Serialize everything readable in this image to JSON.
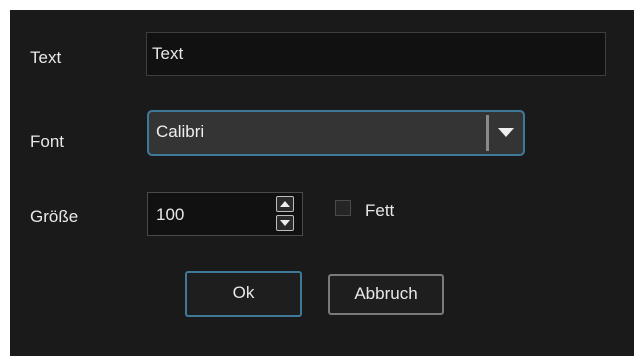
{
  "dialog": {
    "text_row": {
      "label": "Text",
      "value": "Text"
    },
    "font_row": {
      "label": "Font",
      "selected": "Calibri",
      "dropdown_icon": "chevron-down-icon"
    },
    "size_row": {
      "label": "Größe",
      "value": "100",
      "up_icon": "arrow-up-icon",
      "down_icon": "arrow-down-icon"
    },
    "bold": {
      "label": "Fett",
      "checked": false
    },
    "buttons": {
      "ok": "Ok",
      "cancel": "Abbruch"
    }
  },
  "colors": {
    "background": "#1a1a1a",
    "focus_border": "#3e7a98",
    "text": "#e8e8e8"
  }
}
